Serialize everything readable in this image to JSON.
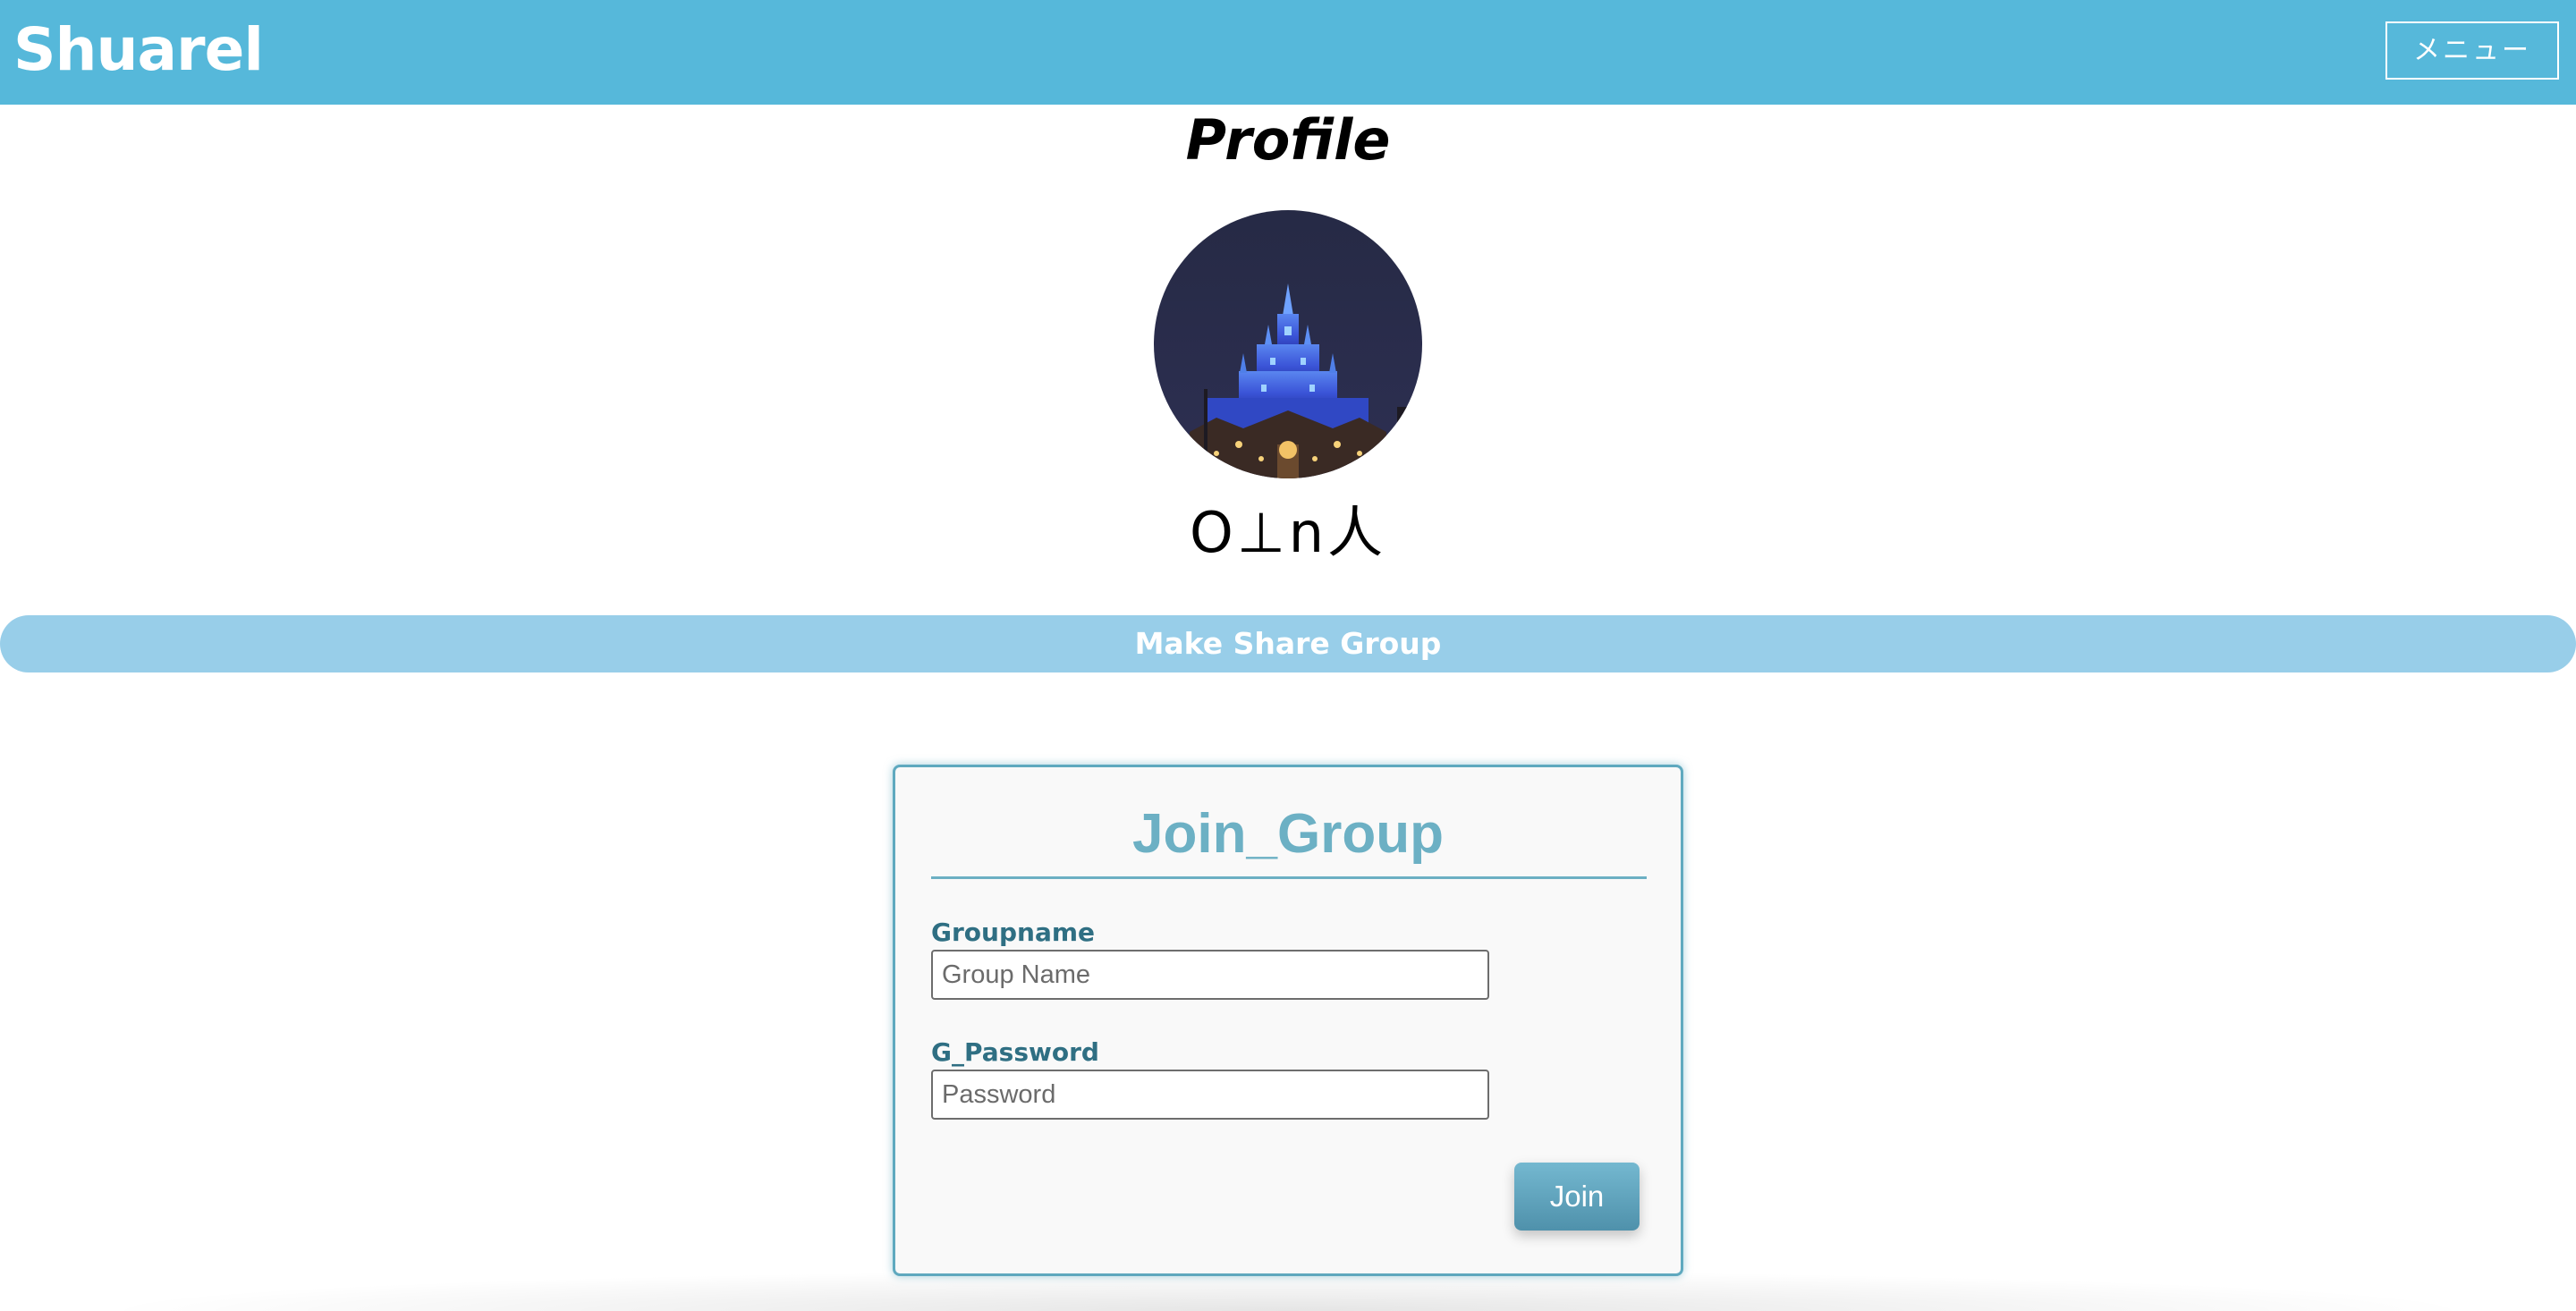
{
  "header": {
    "brand": "Shuarel",
    "menu_label": "メニュー"
  },
  "profile": {
    "title": "Profile",
    "avatar_icon": "castle-night-photo",
    "username": "O⊥n人"
  },
  "share_group": {
    "label": "Make Share Group"
  },
  "join_group": {
    "title": "Join_Group",
    "groupname_label": "Groupname",
    "groupname_placeholder": "Group Name",
    "groupname_value": "",
    "password_label": "G_Password",
    "password_placeholder": "Password",
    "password_value": "",
    "join_label": "Join"
  },
  "colors": {
    "header_bg": "#56b8da",
    "share_bar_bg": "#98cee9",
    "card_accent": "#6cb0c4",
    "label_color": "#2f6f83"
  }
}
